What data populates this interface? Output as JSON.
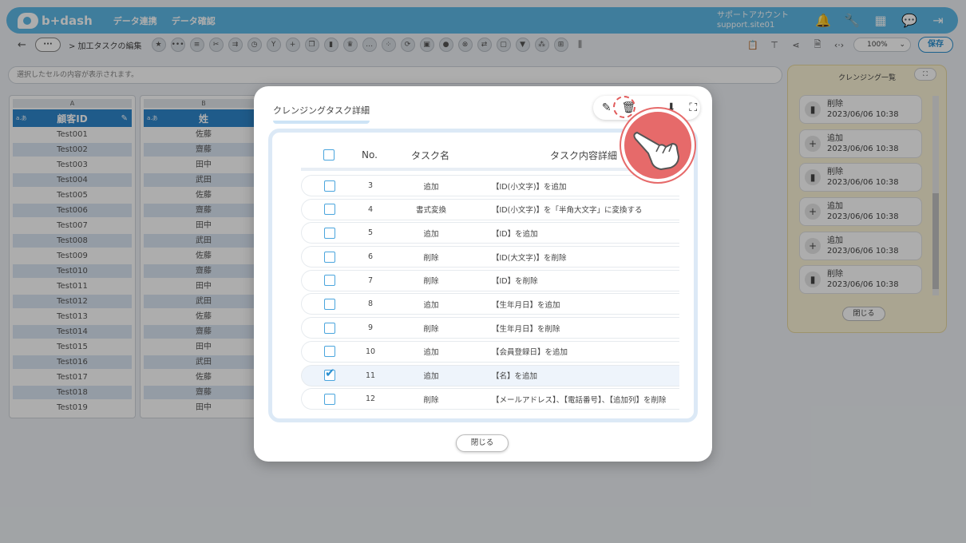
{
  "header": {
    "logo_text": "b+dash",
    "nav": [
      "データ連携",
      "データ確認"
    ],
    "account_line1": "サポートアカウント",
    "account_line2": "support.site01"
  },
  "toolbar": {
    "breadcrumb": "> 加工タスクの編集",
    "zoom": "100%",
    "save_label": "保存"
  },
  "cellbar": {
    "placeholder": "選択したセルの内容が表示されます。"
  },
  "sheet": {
    "col_a": {
      "letter": "A",
      "header": "顧客ID",
      "tag": "a.あ"
    },
    "col_b": {
      "letter": "B",
      "header": "姓",
      "tag": "a.あ"
    },
    "rows_a": [
      "Test001",
      "Test002",
      "Test003",
      "Test004",
      "Test005",
      "Test006",
      "Test007",
      "Test008",
      "Test009",
      "Test010",
      "Test011",
      "Test012",
      "Test013",
      "Test014",
      "Test015",
      "Test016",
      "Test017",
      "Test018",
      "Test019"
    ],
    "rows_b": [
      "佐藤",
      "齋藤",
      "田中",
      "武田",
      "佐藤",
      "齋藤",
      "田中",
      "武田",
      "佐藤",
      "齋藤",
      "田中",
      "武田",
      "佐藤",
      "齋藤",
      "田中",
      "武田",
      "佐藤",
      "齋藤",
      "田中"
    ]
  },
  "side_panel": {
    "title": "クレンジング一覧",
    "close_label": "閉じる",
    "items": [
      {
        "action": "削除",
        "icon": "trash-icon",
        "time": "2023/06/06 10:38"
      },
      {
        "action": "追加",
        "icon": "plus-icon",
        "time": "2023/06/06 10:38"
      },
      {
        "action": "削除",
        "icon": "trash-icon",
        "time": "2023/06/06 10:38"
      },
      {
        "action": "追加",
        "icon": "plus-icon",
        "time": "2023/06/06 10:38"
      },
      {
        "action": "追加",
        "icon": "plus-icon",
        "time": "2023/06/06 10:38"
      },
      {
        "action": "削除",
        "icon": "trash-icon",
        "time": "2023/06/06 10:38"
      }
    ]
  },
  "modal": {
    "title": "クレンジングタスク詳細",
    "close_label": "閉じる",
    "columns": {
      "no": "No.",
      "name": "タスク名",
      "detail": "タスク内容詳細"
    },
    "rows": [
      {
        "no": "3",
        "name": "追加",
        "detail": "【ID(小文字)】を追加",
        "checked": false
      },
      {
        "no": "4",
        "name": "書式変換",
        "detail": "【ID(小文字)】を「半角大文字」に変換する",
        "checked": false
      },
      {
        "no": "5",
        "name": "追加",
        "detail": "【ID】を追加",
        "checked": false
      },
      {
        "no": "6",
        "name": "削除",
        "detail": "【ID(大文字)】を削除",
        "checked": false
      },
      {
        "no": "7",
        "name": "削除",
        "detail": "【ID】を削除",
        "checked": false
      },
      {
        "no": "8",
        "name": "追加",
        "detail": "【生年月日】を追加",
        "checked": false
      },
      {
        "no": "9",
        "name": "削除",
        "detail": "【生年月日】を削除",
        "checked": false
      },
      {
        "no": "10",
        "name": "追加",
        "detail": "【会員登録日】を追加",
        "checked": false
      },
      {
        "no": "11",
        "name": "追加",
        "detail": "【名】を追加",
        "checked": true
      },
      {
        "no": "12",
        "name": "削除",
        "detail": "【メールアドレス】、【電話番号】、【追加列】を削除",
        "checked": false
      }
    ]
  },
  "colors": {
    "accent": "#2a8fd0",
    "header": "#5db8e6",
    "pointer": "#e66a6a"
  }
}
